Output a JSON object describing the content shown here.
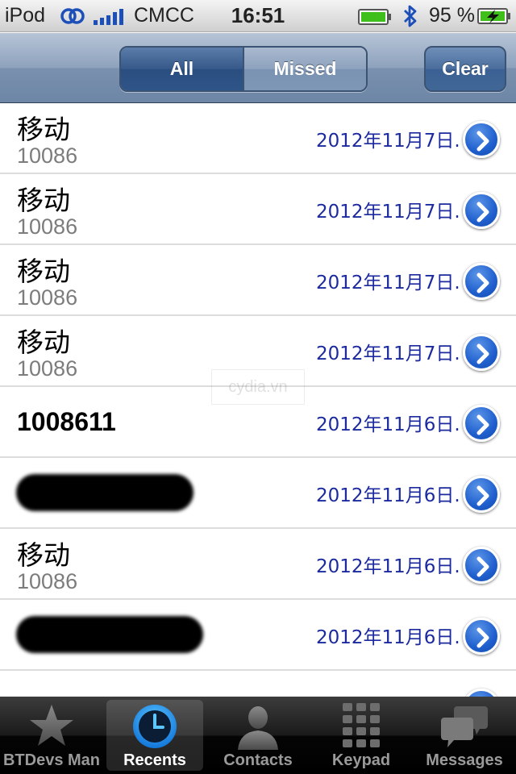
{
  "status_bar": {
    "device": "iPod",
    "carrier": "CMCC",
    "time": "16:51",
    "battery_percent": "95 %"
  },
  "nav": {
    "segments": [
      {
        "label": "All",
        "selected": true
      },
      {
        "label": "Missed",
        "selected": false
      }
    ],
    "clear_label": "Clear"
  },
  "calls": [
    {
      "name": "移动",
      "number": "10086",
      "date": "2012年11月7日..."
    },
    {
      "name": "移动",
      "number": "10086",
      "date": "2012年11月7日..."
    },
    {
      "name": "移动",
      "number": "10086",
      "date": "2012年11月7日..."
    },
    {
      "name": "移动",
      "number": "10086",
      "date": "2012年11月7日..."
    },
    {
      "name": "1008611",
      "number": "",
      "date": "2012年11月6日..."
    },
    {
      "name": "",
      "number": "",
      "date": "2012年11月6日...",
      "redacted": true
    },
    {
      "name": "移动",
      "number": "10086",
      "date": "2012年11月6日..."
    },
    {
      "name": "",
      "number": "",
      "date": "2012年11月6日...",
      "redacted": true
    }
  ],
  "watermark": "cydia.vn",
  "tabs": [
    {
      "label": "BTDevs Man",
      "icon": "star-icon",
      "selected": false
    },
    {
      "label": "Recents",
      "icon": "clock-icon",
      "selected": true
    },
    {
      "label": "Contacts",
      "icon": "person-icon",
      "selected": false
    },
    {
      "label": "Keypad",
      "icon": "keypad-icon",
      "selected": false
    },
    {
      "label": "Messages",
      "icon": "messages-icon",
      "selected": false
    }
  ],
  "colors": {
    "date_text": "#1b2a9e",
    "arrow_blue": "#1f5fce",
    "nav_bar": "#7a91ae"
  }
}
